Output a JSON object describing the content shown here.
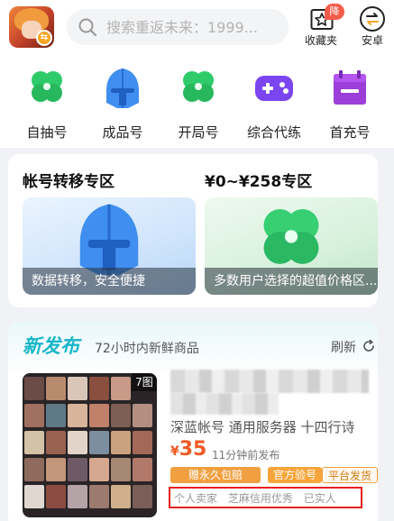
{
  "header": {
    "search": {
      "placeholder": "搜索重返未来：1999..."
    },
    "favorites": {
      "label": "收藏夹",
      "badge": "降"
    },
    "android": {
      "label": "安卓"
    }
  },
  "categories": [
    {
      "label": "自抽号",
      "icon": "clover-icon"
    },
    {
      "label": "成品号",
      "icon": "helmet-icon"
    },
    {
      "label": "开局号",
      "icon": "clover-icon"
    },
    {
      "label": "综合代练",
      "icon": "gamepad-icon"
    },
    {
      "label": "首充号",
      "icon": "gift-box-icon"
    }
  ],
  "transfer": {
    "left_title": "帐号转移专区",
    "right_title": "¥0~¥258专区",
    "left_caption": "数据转移，安全便捷",
    "right_caption": "多数用户选择的超值价格区..."
  },
  "release": {
    "title": "新发布",
    "subtitle": "72小时内新鲜商品",
    "refresh": "刷新",
    "item": {
      "image_count": "7图",
      "description": "深蓝帐号 通用服务器 十四行诗",
      "price_symbol": "¥",
      "price": "35",
      "posted": "11分钟前发布",
      "tags": [
        "赠永久包赔",
        "官方验号",
        "平台发货"
      ],
      "trust": [
        "个人卖家",
        "芝麻信用优秀",
        "已实人"
      ]
    }
  },
  "colors": {
    "accent": "#18b6c8",
    "price": "#f05a24",
    "highlight_border": "#e62020"
  }
}
